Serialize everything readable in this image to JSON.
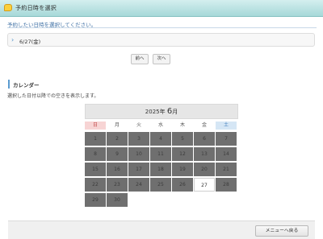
{
  "window": {
    "title": "予約日時を選択"
  },
  "instruction": "予約したい日時を選択してください。",
  "selected_date": {
    "label": "6/27(金)"
  },
  "nav": {
    "prev_label": "前へ",
    "next_label": "次へ"
  },
  "calendar_section": {
    "title": "カレンダー",
    "description": "選択した日付以降での空きを表示します。"
  },
  "calendar": {
    "year": "2025",
    "year_suffix": "年",
    "month": "6",
    "month_suffix": "月",
    "weekdays": [
      "日",
      "月",
      "火",
      "水",
      "木",
      "金",
      "土"
    ],
    "rows": [
      [
        "1",
        "2",
        "3",
        "4",
        "5",
        "6",
        "7"
      ],
      [
        "8",
        "9",
        "10",
        "11",
        "12",
        "13",
        "14"
      ],
      [
        "15",
        "16",
        "17",
        "18",
        "19",
        "20",
        "21"
      ],
      [
        "22",
        "23",
        "24",
        "25",
        "26",
        "27",
        "28"
      ],
      [
        "29",
        "30"
      ]
    ],
    "available_days": [
      "27"
    ]
  },
  "footer": {
    "menu_button_label": "メニューへ戻る"
  }
}
